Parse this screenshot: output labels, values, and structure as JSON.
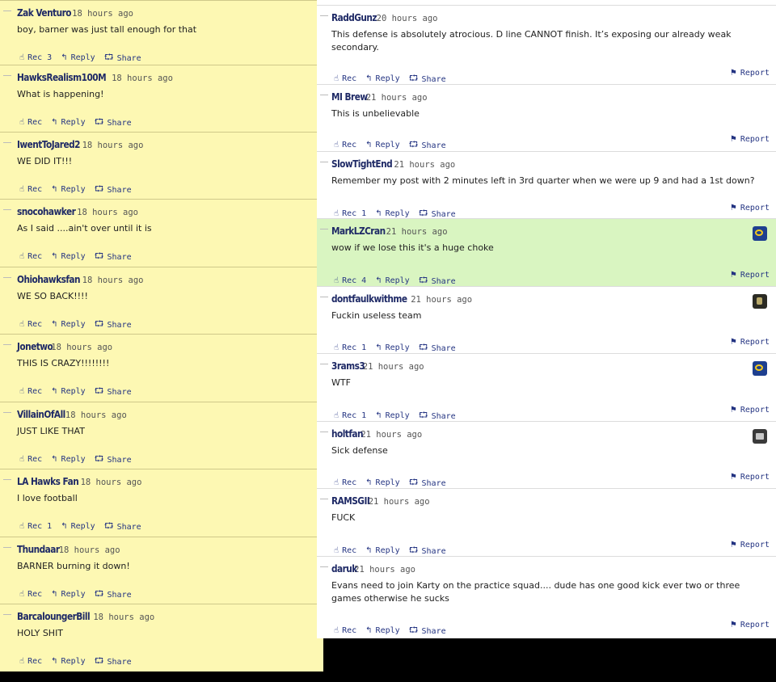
{
  "left_comments": [
    {
      "user": "Zak Venturo",
      "time": "18 hours ago",
      "body": "boy, barner was just tall enough for that",
      "rec": "Rec 3",
      "reply": "Reply",
      "share": "Share"
    },
    {
      "user": "HawksRealism100M",
      "time": "18 hours ago",
      "body": "What is happening!",
      "rec": "Rec",
      "reply": "Reply",
      "share": "Share"
    },
    {
      "user": "IwentToJared2",
      "time": "18 hours ago",
      "body": "WE DID IT!!!",
      "rec": "Rec",
      "reply": "Reply",
      "share": "Share"
    },
    {
      "user": "snocohawker",
      "time": "18 hours ago",
      "body": "As I said ....ain't over until it is",
      "rec": "Rec",
      "reply": "Reply",
      "share": "Share"
    },
    {
      "user": "Ohiohawksfan",
      "time": "18 hours ago",
      "body": "WE SO BACK!!!!",
      "rec": "Rec",
      "reply": "Reply",
      "share": "Share"
    },
    {
      "user": "Jonetwo",
      "time": "18 hours ago",
      "body": "THIS IS CRAZY!!!!!!!!",
      "rec": "Rec",
      "reply": "Reply",
      "share": "Share"
    },
    {
      "user": "VillainOfAll",
      "time": "18 hours ago",
      "body": "JUST LIKE THAT",
      "rec": "Rec",
      "reply": "Reply",
      "share": "Share"
    },
    {
      "user": "LA Hawks Fan",
      "time": "18 hours ago",
      "body": "I love football",
      "rec": "Rec 1",
      "reply": "Reply",
      "share": "Share"
    },
    {
      "user": "Thundaar",
      "time": "18 hours ago",
      "body": "BARNER burning it down!",
      "rec": "Rec",
      "reply": "Reply",
      "share": "Share"
    },
    {
      "user": "BarcaloungerBill",
      "time": "18 hours ago",
      "body": "HOLY SHIT",
      "rec": "Rec",
      "reply": "Reply",
      "share": "Share"
    }
  ],
  "right_comments": [
    {
      "user": "RaddGunz",
      "time": "20 hours ago",
      "body": "This defense is absolutely atrocious. D line CANNOT finish. It’s exposing our already weak secondary.",
      "rec": "Rec",
      "reply": "Reply",
      "share": "Share",
      "report": "Report",
      "avatar": "",
      "highlight": false
    },
    {
      "user": "MI Brew",
      "time": "21 hours ago",
      "body": "This is unbelievable",
      "rec": "Rec",
      "reply": "Reply",
      "share": "Share",
      "report": "Report",
      "avatar": "",
      "highlight": false
    },
    {
      "user": "SlowTightEnd",
      "time": "21 hours ago",
      "body": "Remember my post with 2 minutes left in 3rd quarter when we were up 9 and had a 1st down?",
      "rec": "Rec 1",
      "reply": "Reply",
      "share": "Share",
      "report": "Report",
      "avatar": "",
      "highlight": false
    },
    {
      "user": "MarkLZCran",
      "time": "21 hours ago",
      "body": "wow if we lose this it's a huge choke",
      "rec": "Rec 4",
      "reply": "Reply",
      "share": "Share",
      "report": "Report",
      "avatar": "rams-logo-avatar",
      "highlight": true
    },
    {
      "user": "dontfaulkwithme",
      "time": "21 hours ago",
      "body": "Fuckin useless team",
      "rec": "Rec 1",
      "reply": "Reply",
      "share": "Share",
      "report": "Report",
      "avatar": "user-photo-avatar",
      "highlight": false
    },
    {
      "user": "3rams3",
      "time": "21 hours ago",
      "body": "WTF",
      "rec": "Rec 1",
      "reply": "Reply",
      "share": "Share",
      "report": "Report",
      "avatar": "rams-logo-avatar",
      "highlight": false
    },
    {
      "user": "holtfan",
      "time": "21 hours ago",
      "body": "Sick defense",
      "rec": "Rec",
      "reply": "Reply",
      "share": "Share",
      "report": "Report",
      "avatar": "user-photo-avatar",
      "highlight": false
    },
    {
      "user": "RAMSGII",
      "time": "21 hours ago",
      "body": "FUCK",
      "rec": "Rec",
      "reply": "Reply",
      "share": "Share",
      "report": "Report",
      "avatar": "",
      "highlight": false
    },
    {
      "user": "daruk",
      "time": "21 hours ago",
      "body": "Evans need to join Karty on the practice squad.... dude has one good kick ever two or three games otherwise he sucks",
      "rec": "Rec",
      "reply": "Reply",
      "share": "Share",
      "report": "Report",
      "avatar": "",
      "highlight": false
    }
  ],
  "icons": {
    "rec": "thumbs-up-icon",
    "reply": "reply-arrow-icon",
    "share": "share-icon",
    "report": "flag-icon"
  },
  "colors": {
    "left_panel_bg": "#fdf8b3",
    "highlight_bg": "#d9f5c1",
    "username": "#1f2a66",
    "action_link": "#243482"
  }
}
